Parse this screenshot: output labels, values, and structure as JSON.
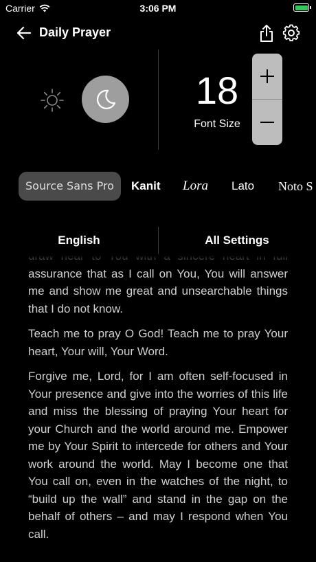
{
  "status": {
    "carrier": "Carrier",
    "time": "3:06 PM"
  },
  "nav": {
    "title": "Daily Prayer"
  },
  "font_size": {
    "value": "18",
    "label": "Font Size"
  },
  "fonts": [
    {
      "label": "Source Sans Pro",
      "selected": true
    },
    {
      "label": "Kanit"
    },
    {
      "label": "Lora"
    },
    {
      "label": "Lato"
    },
    {
      "label": "Noto S"
    }
  ],
  "tabs": {
    "language": "English",
    "settings": "All Settings"
  },
  "content": {
    "paragraphs": [
      "draw near to You with a sincere heart in full assurance that as I call on You, You will answer me and show me great and unsearchable things that I do not know.",
      "Teach me to pray O God! Teach me to pray Your heart, Your will, Your Word.",
      "Forgive me, Lord, for I am often self-focused in Your presence and give into the worries of this life and miss the blessing of praying Your heart for your Church and the world around me. Empower me by Your Spirit to intercede for others and Your work around the world. May I become one that You call on, even in the watches of the night, to “build up the wall” and stand in the gap on the behalf of others – and may I respond when You call."
    ]
  },
  "colors": {
    "background": "#000000",
    "battery": "#34c759",
    "moon_button": "#9e9e9e",
    "stepper": "#bdbdbd",
    "selected_chip": "#4a4a4a"
  }
}
